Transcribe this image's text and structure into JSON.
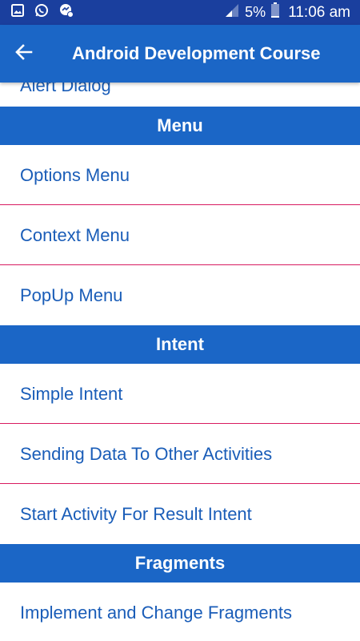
{
  "status_bar": {
    "icons": [
      "image-icon",
      "whatsapp-icon",
      "messenger-icon",
      "signal-icon",
      "battery-icon"
    ],
    "battery": "5%",
    "time": "11:06 am"
  },
  "app_bar": {
    "title": "Android Development Course",
    "back_icon": "arrow-back-icon"
  },
  "list": {
    "partial_item": "Alert Dialog",
    "sections": [
      {
        "header": "Menu",
        "items": [
          "Options Menu",
          "Context Menu",
          "PopUp Menu"
        ]
      },
      {
        "header": "Intent",
        "items": [
          "Simple Intent",
          "Sending Data To Other Activities",
          "Start Activity For Result Intent"
        ]
      },
      {
        "header": "Fragments",
        "items": [
          "Implement and Change Fragments"
        ]
      }
    ]
  },
  "colors": {
    "status_bar": "#1a3f9e",
    "app_bar": "#1b66c6",
    "section_header": "#1b66c6",
    "item_text": "#1a5db8",
    "divider": "#d81b60"
  }
}
